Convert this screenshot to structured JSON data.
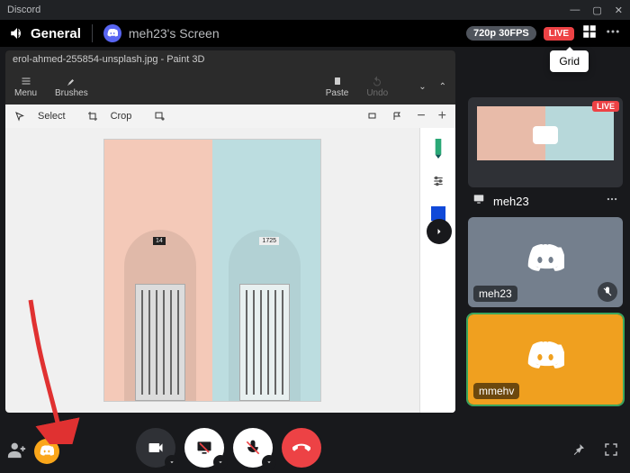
{
  "app": {
    "name": "Discord"
  },
  "callbar": {
    "channel": "General",
    "screen_owner": "meh23's Screen",
    "quality_pill": "720p 30FPS",
    "live_label": "LIVE",
    "grid_tooltip": "Grid"
  },
  "stream": {
    "paint3d_title": "erol-ahmed-255854-unsplash.jpg - Paint 3D",
    "ribbon": {
      "menu": "Menu",
      "brushes": "Brushes",
      "paste": "Paste",
      "undo": "Undo"
    },
    "tools": {
      "select": "Select",
      "crop": "Crop"
    },
    "house_numbers": {
      "left": "14",
      "right": "1725"
    }
  },
  "participants": {
    "stream_tile": {
      "name": "meh23",
      "live": "LIVE"
    },
    "tile1": {
      "name": "meh23"
    },
    "tile2": {
      "name": "mmehv"
    }
  },
  "colors": {
    "live_red": "#ed4245",
    "accent_orange": "#f0a01f",
    "discord_blurple": "#5865f2"
  }
}
